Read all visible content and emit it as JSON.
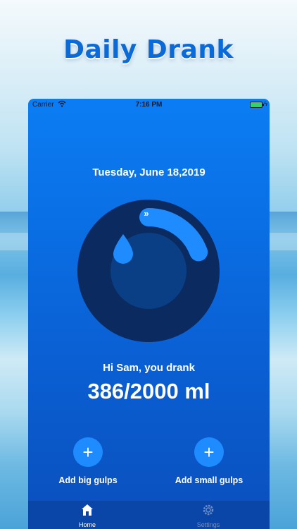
{
  "promo": {
    "headline": "Daily Drank"
  },
  "status_bar": {
    "carrier": "Carrier",
    "time": "7:16 PM",
    "battery_icon": "battery-charging-icon",
    "wifi_icon": "wifi-icon"
  },
  "home": {
    "date": "Tuesday, June 18,2019",
    "greeting": "Hi Sam, you drank",
    "amount": "386/2000 ml",
    "progress_fraction": 0.193,
    "progress_icon": "double-arrow-right-icon",
    "center_icon": "water-drop-icon",
    "buttons": {
      "add_big_icon": "+",
      "add_big_label": "Add big gulps",
      "add_small_icon": "+",
      "add_small_label": "Add small gulps"
    }
  },
  "tab_bar": {
    "tabs": [
      {
        "label": "Home",
        "icon": "house-icon",
        "active": true
      },
      {
        "label": "Settings",
        "icon": "gear-icon",
        "active": false
      }
    ]
  },
  "colors": {
    "accent": "#1e8bff",
    "background_top": "#0b7df4",
    "ring_dark": "#0b2a5f",
    "ring_inner": "#0b3f85",
    "headline": "#0a6bd8"
  }
}
